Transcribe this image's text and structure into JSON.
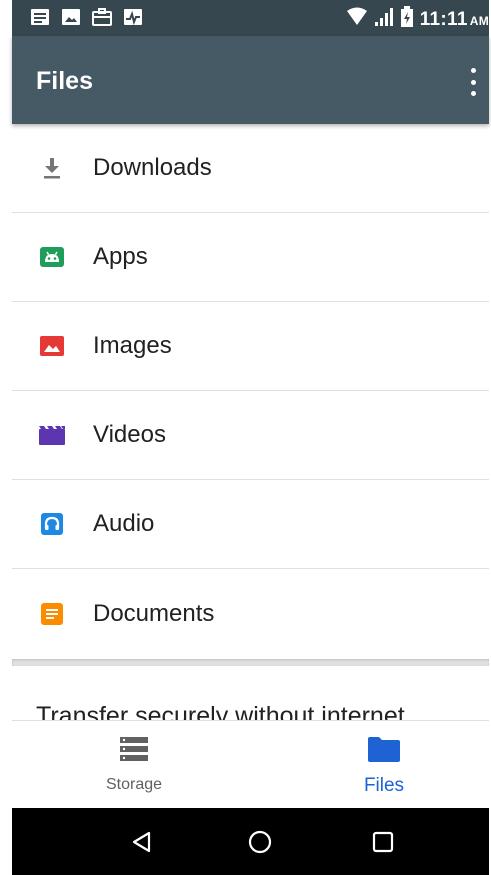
{
  "status_bar": {
    "time": "11:11",
    "ampm": "AM",
    "left_icons": [
      "message-icon",
      "image-icon",
      "briefcase-icon",
      "activity-icon"
    ],
    "right_icons": [
      "wifi-icon",
      "signal-icon",
      "battery-icon"
    ]
  },
  "app_bar": {
    "title": "Files",
    "overflow_icon": "more-vert-icon",
    "background": "#455a64"
  },
  "categories": [
    {
      "label": "Downloads",
      "icon": "download-icon",
      "color": "#757575"
    },
    {
      "label": "Apps",
      "icon": "android-icon",
      "color": "#1e9e5a"
    },
    {
      "label": "Images",
      "icon": "image-icon",
      "color": "#e53935"
    },
    {
      "label": "Videos",
      "icon": "video-icon",
      "color": "#5e35b1"
    },
    {
      "label": "Audio",
      "icon": "headphones-icon",
      "color": "#1e88e5"
    },
    {
      "label": "Documents",
      "icon": "document-icon",
      "color": "#fb8c00"
    }
  ],
  "transfer": {
    "text": "Transfer securely without internet"
  },
  "bottom_nav": {
    "storage_label": "Storage",
    "files_label": "Files",
    "active": "Files",
    "active_color": "#1e62d4"
  },
  "system_nav": {
    "buttons": [
      "back-icon",
      "home-icon",
      "recents-icon"
    ]
  }
}
